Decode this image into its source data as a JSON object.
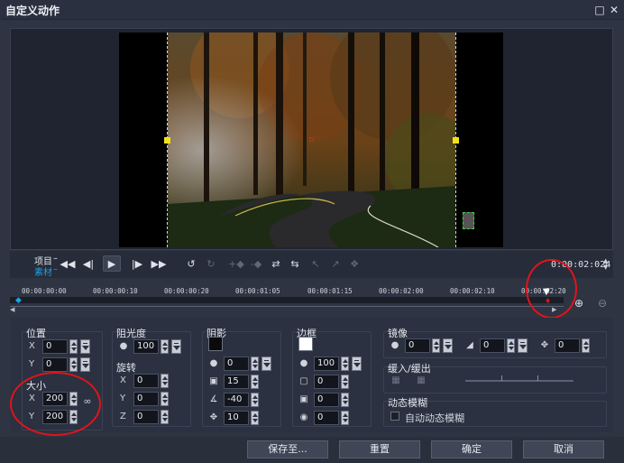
{
  "window": {
    "title": "自定义动作",
    "maximize_icon": "maximize-icon",
    "close_icon": "close-icon"
  },
  "player": {
    "project_label": "项目",
    "clip_label": "素材",
    "timecode": "0:00:02:024",
    "buttons": [
      "go-to-start-icon",
      "prev-frame-icon",
      "play-icon",
      "next-frame-icon",
      "go-to-end-icon",
      "undo-icon",
      "redo-icon",
      "add-keyframe-icon",
      "remove-keyframe-icon",
      "reverse-keyframe-icon",
      "move-keyframe-left-icon",
      "move-keyframe-right-icon",
      "copy-keyframe-icon",
      "paste-keyframe-icon"
    ]
  },
  "timeline": {
    "ticks": [
      "00:00:00:00",
      "00:00:00:10",
      "00:00:00:20",
      "00:00:01:05",
      "00:00:01:15",
      "00:00:02:00",
      "00:00:02:10",
      "00:00:02:20"
    ],
    "zoom_in_icon": "zoom-in-icon",
    "zoom_out_icon": "zoom-out-icon"
  },
  "position": {
    "heading": "位置",
    "x_label": "X",
    "x_value": "0",
    "y_label": "Y",
    "y_value": "0"
  },
  "size": {
    "heading": "大小",
    "x_label": "X",
    "x_value": "200",
    "y_label": "Y",
    "y_value": "200"
  },
  "opacity": {
    "heading": "阻光度",
    "value": "100"
  },
  "rotation": {
    "heading": "旋转",
    "x_label": "X",
    "x_value": "0",
    "y_label": "Y",
    "y_value": "0",
    "z_label": "Z",
    "z_value": "0"
  },
  "shadow": {
    "heading": "阴影",
    "color": "#0b0b0b",
    "opacity": "0",
    "blur": "15",
    "angle": "-40",
    "distance": "10"
  },
  "border": {
    "heading": "边框",
    "color": "#ffffff",
    "opacity": "100",
    "width": "0",
    "blur": "0",
    "softness": "0"
  },
  "mirror": {
    "heading": "镜像",
    "opacity": "0",
    "fade": "0",
    "offset": "0"
  },
  "ease": {
    "heading": "缓入/缓出"
  },
  "motion_blur": {
    "heading": "动态模糊",
    "auto_label": "自动动态模糊",
    "auto_checked": false
  },
  "footer": {
    "save_as": "保存至...",
    "reset": "重置",
    "ok": "确定",
    "cancel": "取消"
  },
  "accent_color": "#1fa0e6",
  "highlight_color": "#e0141a"
}
